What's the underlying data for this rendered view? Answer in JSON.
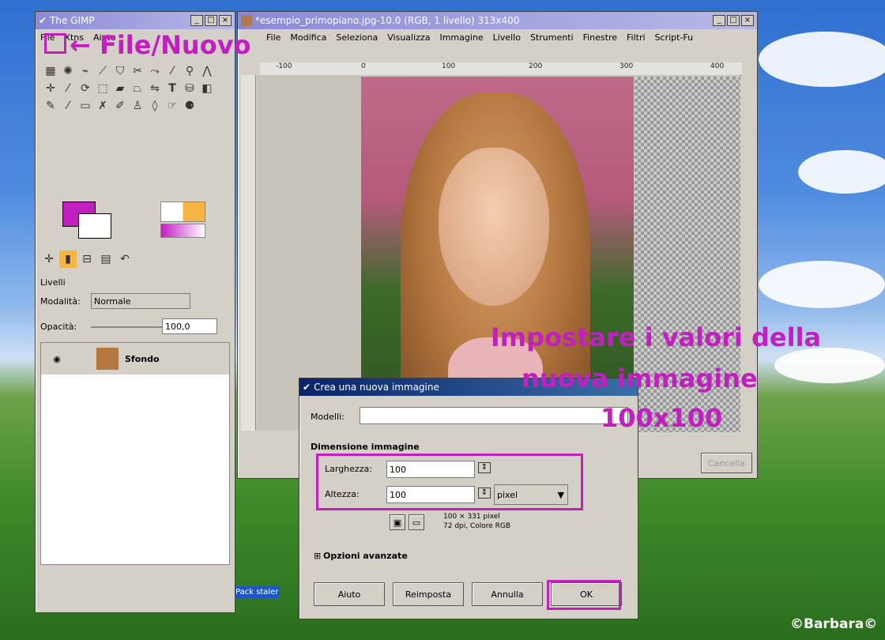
{
  "toolbox": {
    "title": "The GIMP",
    "menus": [
      "File",
      "Xtns",
      "Aiuto"
    ],
    "layers_tab_label": "Livelli",
    "mode_label": "Modalità:",
    "mode_value": "Normale",
    "opacity_label": "Opacità:",
    "opacity_value": "100,0",
    "layer_name": "Sfondo"
  },
  "image_window": {
    "title": "*esempio_primopiano.jpg-10.0 (RGB, 1 livello) 313x400",
    "menus": [
      "File",
      "Modifica",
      "Seleziona",
      "Visualizza",
      "Immagine",
      "Livello",
      "Strumenti",
      "Finestre",
      "Filtri",
      "Script-Fu"
    ],
    "ruler_ticks": [
      "-100",
      "0",
      "100",
      "200",
      "300",
      "400"
    ],
    "cancel_button": "Cancella"
  },
  "dialog": {
    "title": "Crea una nuova immagine",
    "templates_label": "Modelli:",
    "templates_value": "",
    "size_section": "Dimensione immagine",
    "width_label": "Larghezza:",
    "width_value": "100",
    "height_label": "Altezza:",
    "height_value": "100",
    "unit": "pixel",
    "info_line1": "100 × 331 pixel",
    "info_line2": "72 dpi, Colore RGB",
    "advanced_label": "Opzioni avanzate",
    "help_button": "Aiuto",
    "reset_button": "Reimposta",
    "cancel_button": "Annulla",
    "ok_button": "OK"
  },
  "annotations": {
    "file_new": "File/Nuovo",
    "instruction_line1": "Impostare i valori della",
    "instruction_line2": "nuova immagine",
    "instruction_line3": "100x100",
    "highlight_color": "#c21fc1"
  },
  "desktop": {
    "watermark": "©Barbara©",
    "taskbar_item": "Pack staler"
  }
}
